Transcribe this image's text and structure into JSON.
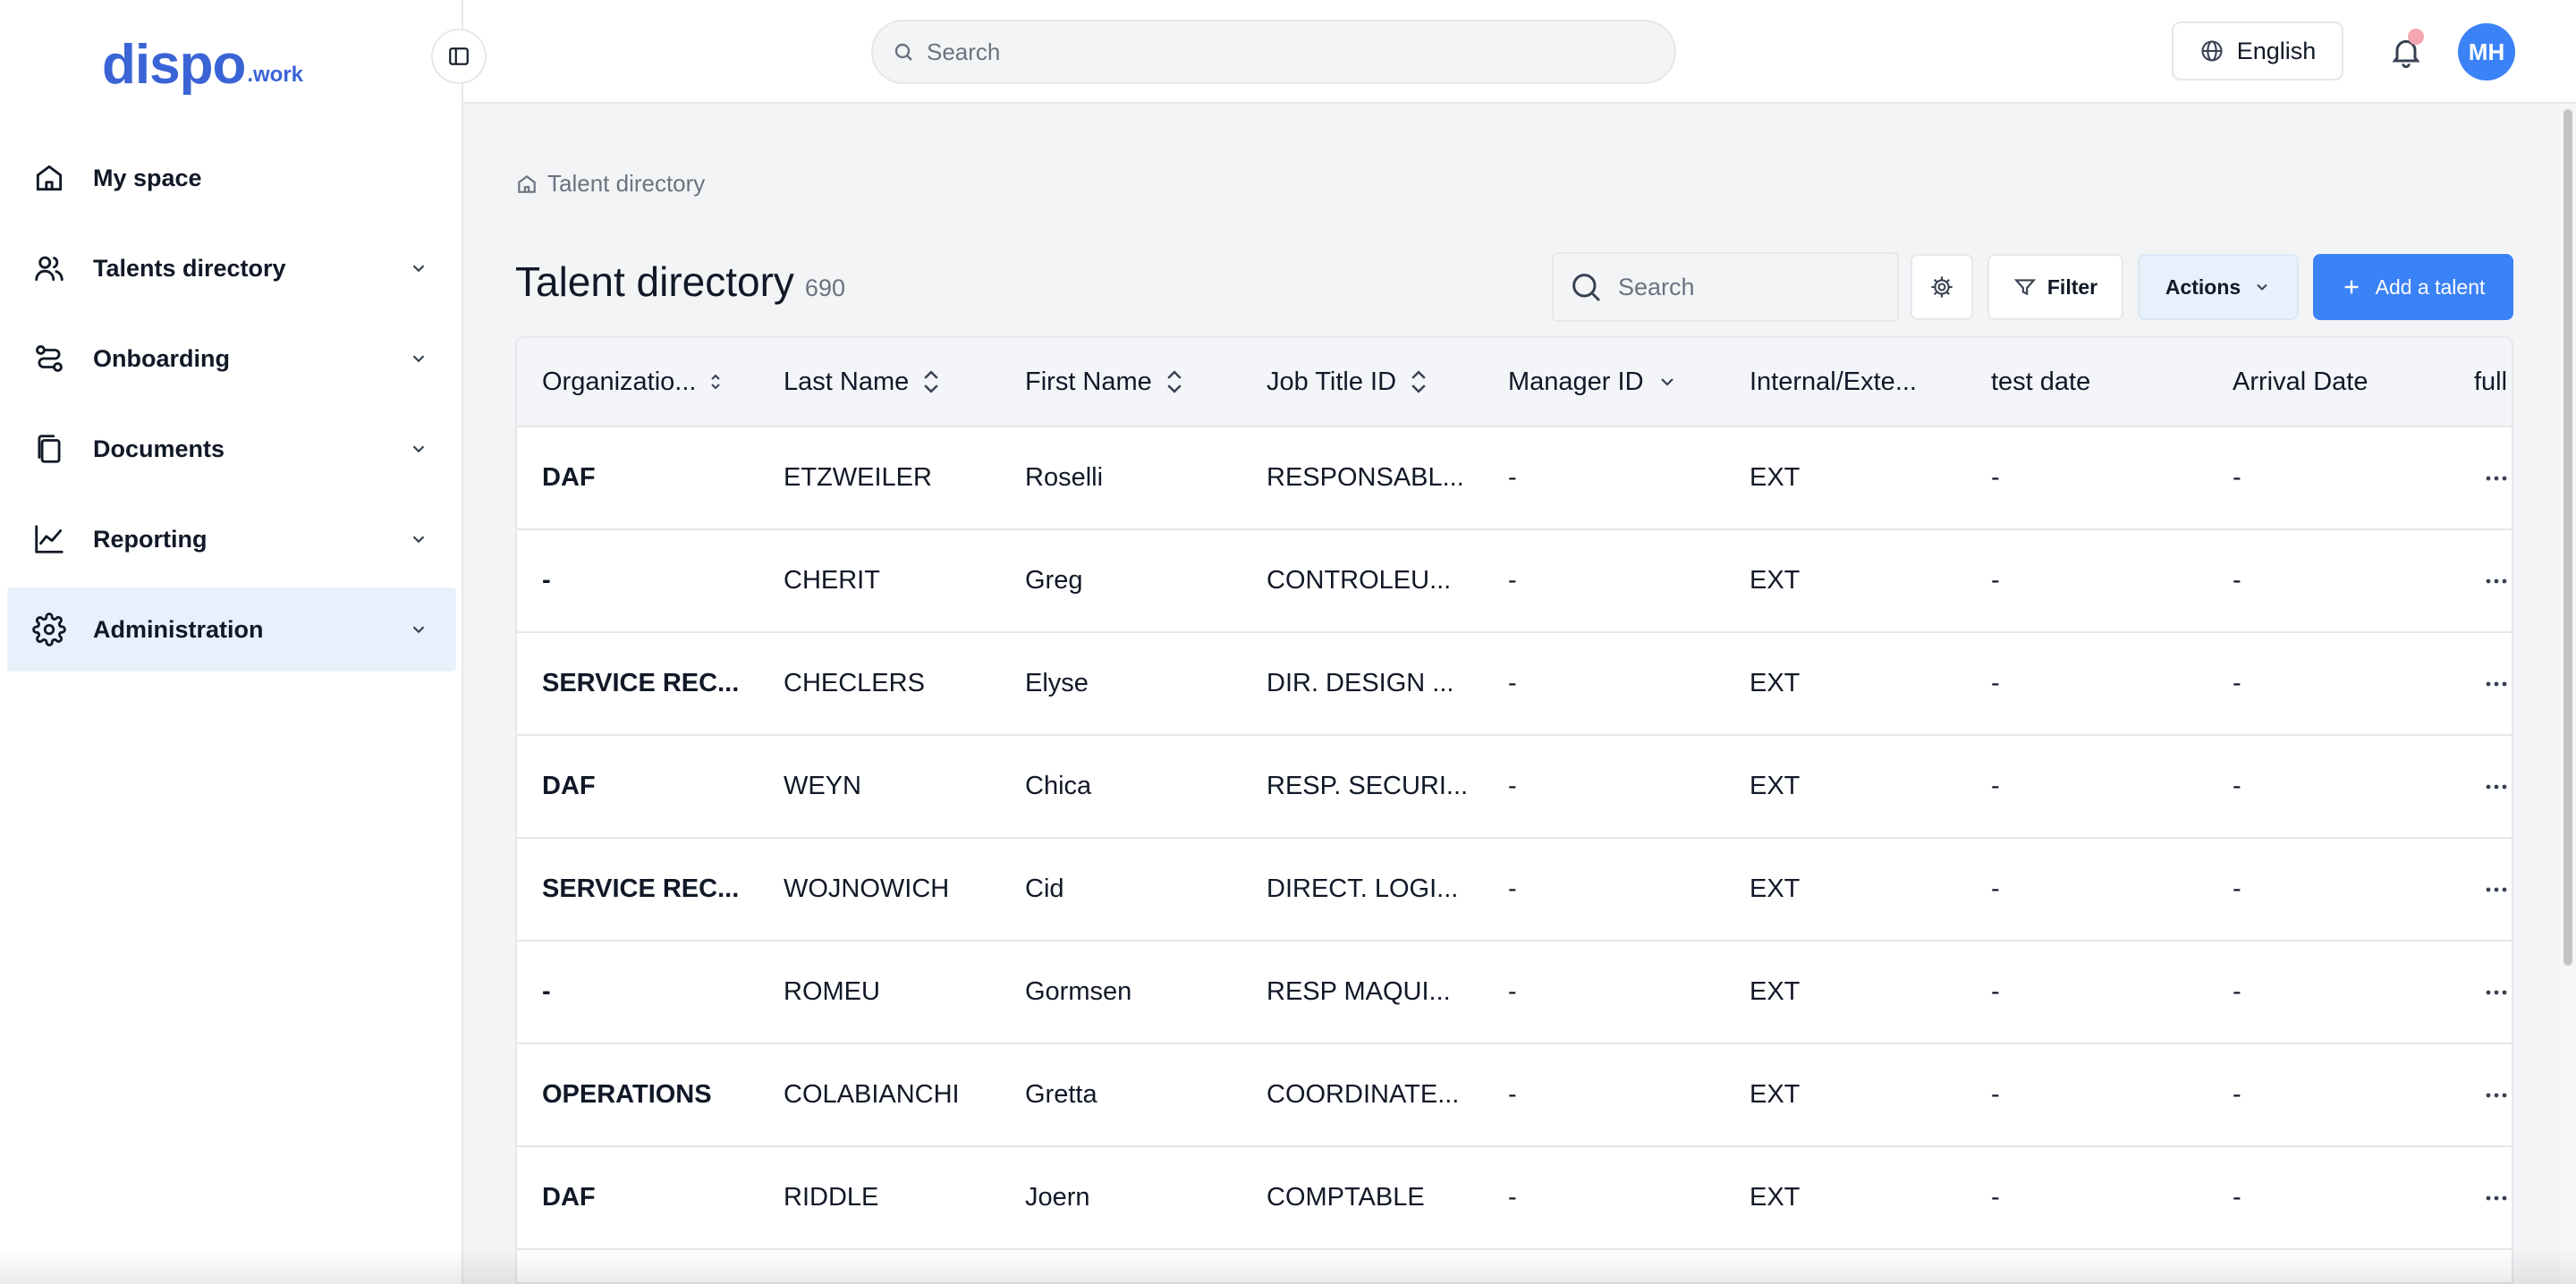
{
  "brand": {
    "name": "dispo",
    "suffix": ".work",
    "color": "#3a63d6"
  },
  "sidebar": {
    "items": [
      {
        "label": "My space",
        "icon": "home-icon",
        "expandable": false,
        "active": false
      },
      {
        "label": "Talents directory",
        "icon": "users-icon",
        "expandable": true,
        "active": false
      },
      {
        "label": "Onboarding",
        "icon": "route-icon",
        "expandable": true,
        "active": false
      },
      {
        "label": "Documents",
        "icon": "documents-icon",
        "expandable": true,
        "active": false
      },
      {
        "label": "Reporting",
        "icon": "chart-icon",
        "expandable": true,
        "active": false
      },
      {
        "label": "Administration",
        "icon": "gear-icon",
        "expandable": true,
        "active": true
      }
    ]
  },
  "header": {
    "search_placeholder": "Search",
    "language": "English",
    "avatar_initials": "MH",
    "accent": "#3b82f6"
  },
  "page": {
    "breadcrumb": "Talent directory",
    "title": "Talent directory",
    "count": "690",
    "search_placeholder": "Search",
    "filter_label": "Filter",
    "actions_label": "Actions",
    "add_label": "Add a talent"
  },
  "table": {
    "columns": [
      {
        "label": "Organizatio...",
        "sort": "small"
      },
      {
        "label": "Last Name",
        "sort": "updown"
      },
      {
        "label": "First Name",
        "sort": "updown"
      },
      {
        "label": "Job Title ID",
        "sort": "updown"
      },
      {
        "label": "Manager ID",
        "sort": "down"
      },
      {
        "label": "Internal/Exte...",
        "sort": "none"
      },
      {
        "label": "test date",
        "sort": "none"
      },
      {
        "label": "Arrival Date",
        "sort": "none"
      },
      {
        "label": "full",
        "sort": "none"
      }
    ],
    "rows": [
      [
        "DAF",
        "ETZWEILER",
        "Roselli",
        "RESPONSABL...",
        "-",
        "EXT",
        "-",
        "-"
      ],
      [
        "-",
        "CHERIT",
        "Greg",
        "CONTROLEU...",
        "-",
        "EXT",
        "-",
        "-"
      ],
      [
        "SERVICE REC...",
        "CHECLERS",
        "Elyse",
        "DIR. DESIGN ...",
        "-",
        "EXT",
        "-",
        "-"
      ],
      [
        "DAF",
        "WEYN",
        "Chica",
        "RESP. SECURI...",
        "-",
        "EXT",
        "-",
        "-"
      ],
      [
        "SERVICE REC...",
        "WOJNOWICH",
        "Cid",
        "DIRECT. LOGI...",
        "-",
        "EXT",
        "-",
        "-"
      ],
      [
        "-",
        "ROMEU",
        "Gormsen",
        "RESP MAQUI...",
        "-",
        "EXT",
        "-",
        "-"
      ],
      [
        "OPERATIONS",
        "COLABIANCHI",
        "Gretta",
        "COORDINATE...",
        "-",
        "EXT",
        "-",
        "-"
      ],
      [
        "DAF",
        "RIDDLE",
        "Joern",
        "COMPTABLE",
        "-",
        "EXT",
        "-",
        "-"
      ]
    ]
  }
}
